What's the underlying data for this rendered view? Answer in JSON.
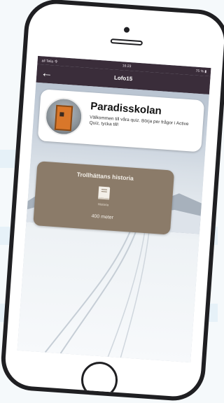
{
  "status_bar": {
    "carrier": "all Telia 令",
    "time": "16:23",
    "battery": "75 % ▮"
  },
  "nav": {
    "back_label": "←",
    "title": "Lofo15"
  },
  "school": {
    "name": "Paradisskolan",
    "description": "Välkommen till våra quiz. Börja per frågor i Active Quiz, tycka till!"
  },
  "location": {
    "title": "Trollhättans historia",
    "category_label": "Historia",
    "distance": "400 meter",
    "icon": "book-icon"
  },
  "colors": {
    "navbar": "#3a2d3a",
    "location_card": "#8b7b69"
  }
}
